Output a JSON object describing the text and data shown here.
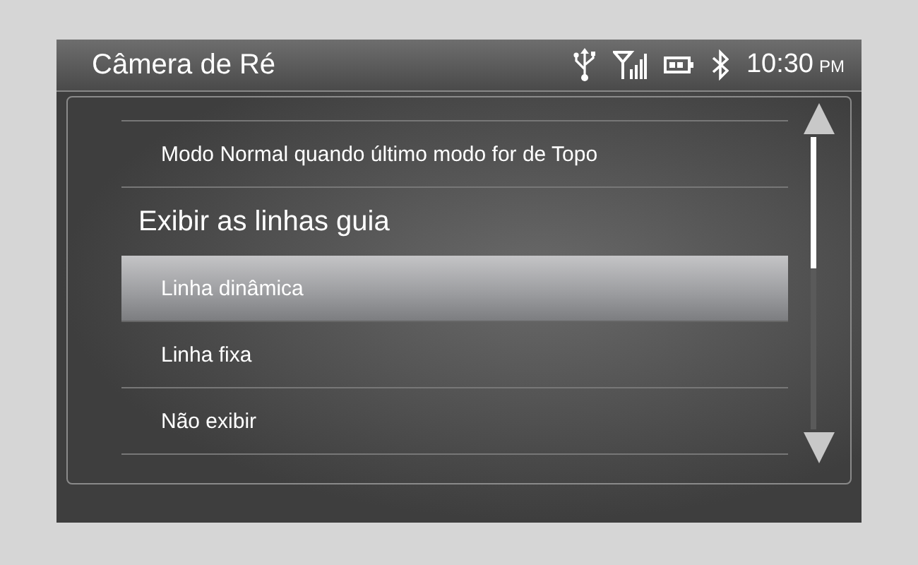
{
  "header": {
    "title": "Câmera de Ré",
    "time": "10:30",
    "period": "PM"
  },
  "list": [
    {
      "kind": "option",
      "label": "Modo Normal quando último modo for de Topo",
      "selected": false
    },
    {
      "kind": "heading",
      "label": "Exibir as linhas guia"
    },
    {
      "kind": "option",
      "label": "Linha dinâmica",
      "selected": true
    },
    {
      "kind": "option",
      "label": "Linha fixa",
      "selected": false
    },
    {
      "kind": "option",
      "label": "Não exibir",
      "selected": false
    }
  ]
}
